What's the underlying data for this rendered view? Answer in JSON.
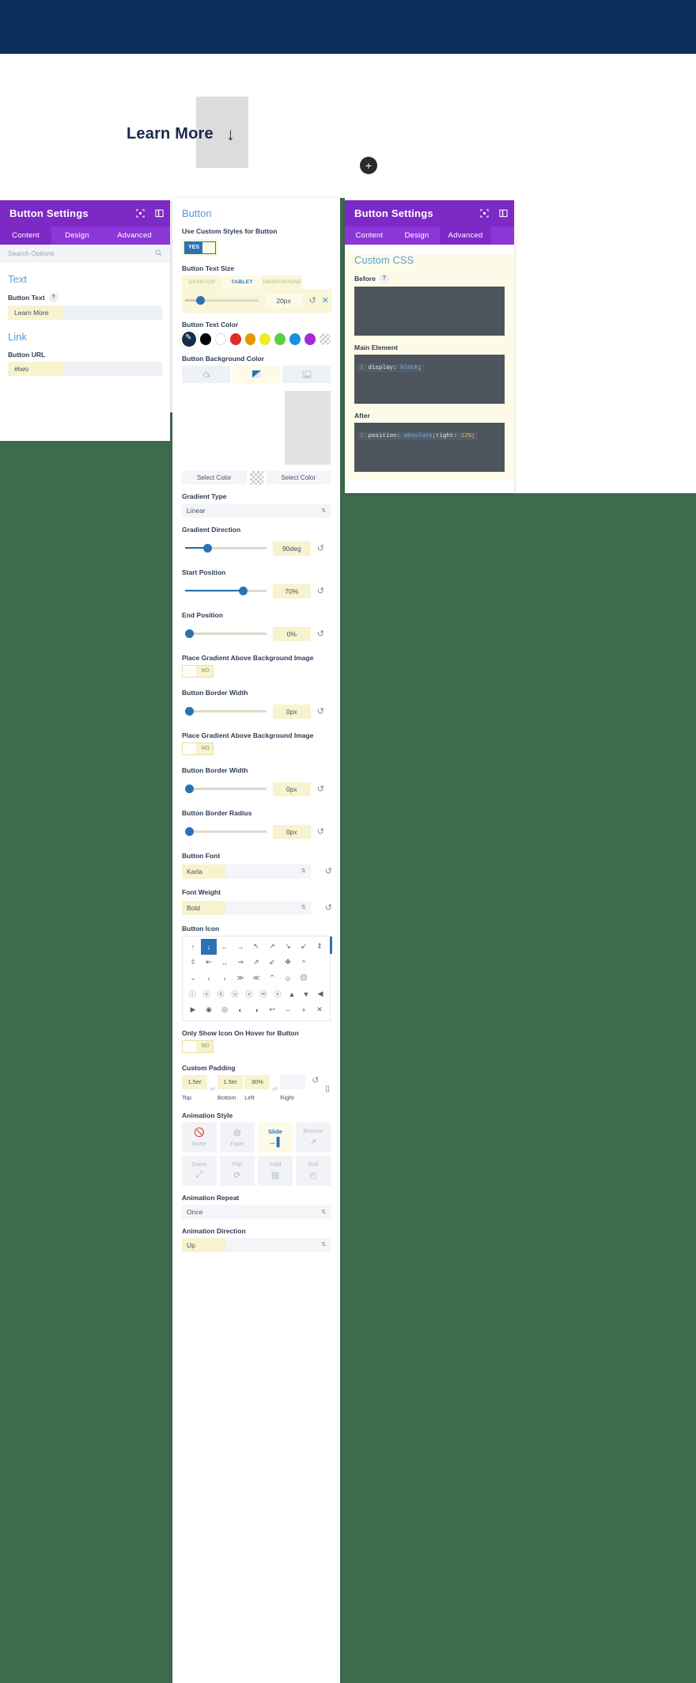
{
  "canvas": {
    "button_text": "Learn More",
    "arrow_icon": "arrow-down-icon",
    "add_icon": "+"
  },
  "left_panel": {
    "title": "Button Settings",
    "tabs": [
      {
        "label": "Content",
        "active": true
      },
      {
        "label": "Design",
        "active": false
      },
      {
        "label": "Advanced",
        "active": false
      }
    ],
    "search_placeholder": "Search Options",
    "sections": [
      {
        "title": "Text",
        "field_label": "Button Text",
        "field_value": "Learn More",
        "has_help": true
      },
      {
        "title": "Link",
        "field_label": "Button URL",
        "field_value": "#two",
        "has_help": false
      }
    ]
  },
  "center_panel": {
    "section_title": "Button",
    "custom_styles": {
      "label": "Use Custom Styles for Button",
      "value": "YES"
    },
    "text_size": {
      "label": "Button Text Size",
      "responsive_tabs": [
        "DESKTOP",
        "TABLET",
        "SMARTPHONE"
      ],
      "active_tab": "TABLET",
      "value": "20px"
    },
    "text_color": {
      "label": "Button Text Color",
      "swatches": [
        "#000000",
        "#ffffff",
        "#e02b20",
        "#e09900",
        "#edec26",
        "#5bd03a",
        "#1b8fe0",
        "#a22bd6"
      ],
      "picker_color": "#152c47"
    },
    "background_color": {
      "label": "Button Background Color",
      "modes": [
        "fill-icon",
        "gradient-icon",
        "image-icon"
      ],
      "active_mode": "gradient-icon",
      "select_left": "Select Color",
      "select_right": "Select Color"
    },
    "gradient_type": {
      "label": "Gradient Type",
      "value": "Linear"
    },
    "gradient_direction": {
      "label": "Gradient Direction",
      "value": "90deg",
      "percent": 25
    },
    "start_position": {
      "label": "Start Position",
      "value": "70%",
      "percent": 70
    },
    "end_position": {
      "label": "End Position",
      "value": "0%",
      "percent": 0
    },
    "place_gradient_1": {
      "label": "Place Gradient Above Background Image",
      "value": "NO"
    },
    "border_width_1": {
      "label": "Button Border Width",
      "value": "0px",
      "percent": 0
    },
    "place_gradient_2": {
      "label": "Place Gradient Above Background Image",
      "value": "NO"
    },
    "border_width_2": {
      "label": "Button Border Width",
      "value": "0px",
      "percent": 0
    },
    "border_radius": {
      "label": "Button Border Radius",
      "value": "0px",
      "percent": 0
    },
    "button_font": {
      "label": "Button Font",
      "value": "Karla"
    },
    "font_weight": {
      "label": "Font Weight",
      "value": "Bold"
    },
    "button_icon": {
      "label": "Button Icon",
      "selected_index": 1,
      "rows": [
        [
          "↑",
          "↓",
          "←",
          "→",
          "↖",
          "↗",
          "↘",
          "↙",
          "⇕"
        ],
        [
          "⇳",
          "⇤",
          "↔",
          "⇝",
          "⇗",
          "⇙",
          "✥",
          "^"
        ],
        [
          "⌄",
          "‹",
          "›",
          "≫",
          "≪",
          "⌃",
          "☺",
          "☹"
        ],
        [
          "ⓘ",
          "ⓞ",
          "ⓠ",
          "ⓤ",
          "ⓥ",
          "ⓦ",
          "ⓧ",
          "▲",
          "▼",
          "◀"
        ],
        [
          "▶",
          "◉",
          "◎",
          "◐",
          "◑",
          "↩",
          "–",
          "+",
          "✕"
        ]
      ]
    },
    "hover_icon": {
      "label": "Only Show Icon On Hover for Button",
      "value": "NO"
    },
    "custom_padding": {
      "label": "Custom Padding",
      "values": [
        "1.5er",
        "1.5er",
        "30%",
        ""
      ],
      "names": [
        "Top",
        "Bottom",
        "Left",
        "Right"
      ]
    },
    "animation_style": {
      "label": "Animation Style",
      "options": [
        {
          "label": "None",
          "icon": "🚫",
          "active": false
        },
        {
          "label": "Fade",
          "icon": "◍",
          "active": false
        },
        {
          "label": "Slide",
          "icon": "→|",
          "active": true
        },
        {
          "label": "Bounce",
          "icon": "↗",
          "active": false
        },
        {
          "label": "Zoom",
          "icon": "⤢",
          "active": false
        },
        {
          "label": "Flip",
          "icon": "⟳",
          "active": false
        },
        {
          "label": "Fold",
          "icon": "▤",
          "active": false
        },
        {
          "label": "Roll",
          "icon": "◴",
          "active": false
        }
      ]
    },
    "animation_repeat": {
      "label": "Animation Repeat",
      "value": "Once"
    },
    "animation_direction": {
      "label": "Animation Direction",
      "value": "Up"
    }
  },
  "right_panel": {
    "title": "Button Settings",
    "tabs": [
      {
        "label": "Content",
        "active": false
      },
      {
        "label": "Design",
        "active": false
      },
      {
        "label": "Advanced",
        "active": true
      }
    ],
    "section_title": "Custom CSS",
    "fields": [
      {
        "label": "Before",
        "has_help": true,
        "line_number": "1",
        "code": "",
        "code_parts": []
      },
      {
        "label": "Main Element",
        "has_help": false,
        "line_number": "1",
        "code": "display: block;",
        "code_parts": [
          {
            "t": "display: ",
            "c": "prop"
          },
          {
            "t": "block",
            "c": "val"
          },
          {
            "t": ";",
            "c": "pl"
          }
        ]
      },
      {
        "label": "After",
        "has_help": false,
        "line_number": "1",
        "code": "position: absolute;right: 12%;",
        "code_parts": [
          {
            "t": "position: ",
            "c": "prop"
          },
          {
            "t": "absolute",
            "c": "val"
          },
          {
            "t": ";right: ",
            "c": "pl"
          },
          {
            "t": "12%",
            "c": "num"
          },
          {
            "t": ";",
            "c": "pl"
          }
        ]
      }
    ]
  },
  "colors": {
    "header_purple": "#7d29c6",
    "tab_purple": "#8c36d8",
    "hero_navy": "#0c2d5e",
    "page_green": "#3d6b4e",
    "accent_blue": "#5b9bd5",
    "highlight_yellow": "#fdfbe8"
  }
}
